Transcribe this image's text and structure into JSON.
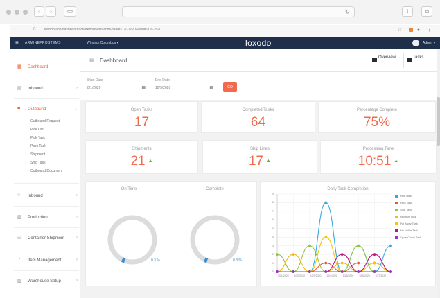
{
  "browser": {
    "url": "loxodo.app/dashboard/?warehouse=89fdd&date=11-1-2020&end=11-8-2020",
    "mac_back": "‹",
    "mac_forward": "›",
    "chrome_nav": "← → C"
  },
  "header": {
    "company": "ARMINEPROSTEMS",
    "site": "Windsor Columbus",
    "brand": "loxodo",
    "user": "Admin"
  },
  "sidebar": {
    "items": [
      {
        "label": "Dashboard",
        "icon": "grid-icon",
        "active": true
      },
      {
        "label": "Inbound",
        "icon": "inbound-icon",
        "active": false
      },
      {
        "label": "Outbound",
        "icon": "truck-icon",
        "active": true
      },
      {
        "label": "Inbound",
        "icon": "circle-icon",
        "active": false
      },
      {
        "label": "Production",
        "icon": "production-icon",
        "active": false
      },
      {
        "label": "Container Shipment",
        "icon": "container-icon",
        "active": false
      },
      {
        "label": "Item Management",
        "icon": "item-icon",
        "active": false
      },
      {
        "label": "Warehouse Setup",
        "icon": "warehouse-icon",
        "active": false
      }
    ],
    "outbound_sub": [
      "Outbound Request",
      "Pick List",
      "Pick Task",
      "Pack Task",
      "Shipment",
      "Ship Task",
      "Outbound Document"
    ]
  },
  "title_bar": {
    "title": "Dashboard",
    "overview_label": "Overview",
    "tasks_label": "Tasks"
  },
  "filters": {
    "start_label": "Start Date",
    "start_value": "8/1/2020",
    "end_label": "End Date",
    "end_value": "10/9/2020",
    "go_label": "GO"
  },
  "stats_top": [
    {
      "label": "Open Tasks",
      "value": "17"
    },
    {
      "label": "Completed Tasks",
      "value": "64"
    },
    {
      "label": "Percentage Complete",
      "value": "75%"
    }
  ],
  "stats_mid": [
    {
      "label": "Shipments",
      "value": "21"
    },
    {
      "label": "Ship Lines",
      "value": "17"
    },
    {
      "label": "Processing Time",
      "value": "10:51"
    }
  ],
  "donuts": [
    {
      "title": "On Time",
      "percent_text": "0.3 %",
      "fraction": 0.003
    },
    {
      "title": "Complete",
      "percent_text": "0.3 %",
      "fraction": 0.003
    }
  ],
  "colors": {
    "accent": "#f26a4b",
    "header_bg": "#1f2f4b",
    "up_arrow": "#7aa83a"
  },
  "chart_data": {
    "type": "line",
    "title": "Daily Task Completion",
    "categories": [
      "10/1/2020",
      "10/2/2020",
      "10/3/2020",
      "10/4/2020",
      "10/5/2020",
      "10/6/2020",
      "10/7/2020"
    ],
    "ylim": [
      0,
      9
    ],
    "yticks": [
      0,
      1,
      2,
      3,
      4,
      5,
      6,
      7,
      8,
      9
    ],
    "grid": true,
    "legend": "right",
    "series": [
      {
        "name": "Pick Task",
        "color": "#34a9e0",
        "values": [
          0,
          0,
          0,
          8,
          0,
          3,
          0,
          3
        ]
      },
      {
        "name": "Pack Task",
        "color": "#e8563a",
        "values": [
          0,
          0,
          0,
          1,
          0,
          1,
          1,
          0
        ]
      },
      {
        "name": "Ship Task",
        "color": "#8fc43f",
        "values": [
          2,
          0,
          3,
          0,
          0,
          3,
          0,
          0
        ]
      },
      {
        "name": "Receive Task",
        "color": "#f4b91b",
        "values": [
          0,
          2,
          0,
          0,
          1,
          0,
          0,
          0
        ]
      },
      {
        "name": "Put Away Task",
        "color": "#f7c600",
        "values": [
          0,
          0,
          0,
          4,
          0,
          0,
          1,
          0
        ]
      },
      {
        "name": "Bin to Bin Task",
        "color": "#b5167f",
        "values": [
          0,
          0,
          0,
          0,
          2,
          0,
          2,
          0
        ]
      },
      {
        "name": "Cycle Count Task",
        "color": "#9b30d9",
        "values": [
          0,
          0,
          0,
          0,
          0,
          0,
          0,
          0
        ]
      }
    ]
  }
}
